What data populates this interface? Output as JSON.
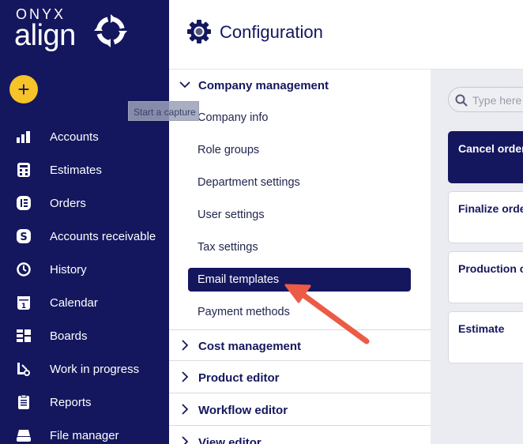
{
  "brand": {
    "top": "ONYX",
    "main": "align"
  },
  "add_button": {
    "label": "+"
  },
  "tooltip": "Start a capture",
  "nav": [
    {
      "label": "Accounts",
      "icon": "chart-icon"
    },
    {
      "label": "Estimates",
      "icon": "calculator-icon"
    },
    {
      "label": "Orders",
      "icon": "orders-icon"
    },
    {
      "label": "Accounts receivable",
      "icon": "dollar-icon"
    },
    {
      "label": "History",
      "icon": "history-icon"
    },
    {
      "label": "Calendar",
      "icon": "calendar-icon"
    },
    {
      "label": "Boards",
      "icon": "boards-icon"
    },
    {
      "label": "Work in progress",
      "icon": "wip-icon"
    },
    {
      "label": "Reports",
      "icon": "reports-icon"
    },
    {
      "label": "File manager",
      "icon": "drive-icon"
    }
  ],
  "header": {
    "title": "Configuration"
  },
  "config": {
    "company_management": {
      "title": "Company management",
      "items": [
        "Company info",
        "Role groups",
        "Department settings",
        "User settings",
        "Tax settings",
        "Email templates",
        "Payment methods"
      ],
      "active": "Email templates"
    },
    "sections": [
      "Cost management",
      "Product editor",
      "Workflow editor",
      "View editor"
    ]
  },
  "content": {
    "search_placeholder": "Type here",
    "cards": [
      "Cancel order",
      "Finalize order",
      "Production order",
      "Estimate"
    ]
  },
  "colors": {
    "sidebar": "#14175e",
    "accent": "#f6c328",
    "arrow": "#ec5b45"
  }
}
